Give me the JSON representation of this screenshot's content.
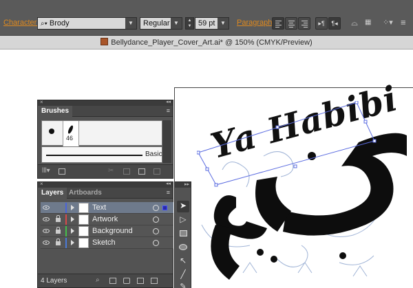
{
  "control_bar": {
    "character_label": "Character:",
    "font_value": "Brody",
    "style_value": "Regular",
    "size_value": "59 pt",
    "paragraph_label": "Paragraph:"
  },
  "document": {
    "title": "Bellydance_Player_Cover_Art.ai* @ 150% (CMYK/Preview)"
  },
  "brushes_panel": {
    "tab": "Brushes",
    "brush_size_label": "46",
    "stroke_label": "Basic"
  },
  "layers_panel": {
    "tabs": [
      "Layers",
      "Artboards"
    ],
    "layers": [
      {
        "name": "Text",
        "color": "#4a63d8",
        "selected": true
      },
      {
        "name": "Artwork",
        "color": "#d84a4a",
        "selected": false
      },
      {
        "name": "Background",
        "color": "#45c04a",
        "selected": false
      },
      {
        "name": "Sketch",
        "color": "#4a7ad8",
        "selected": false
      }
    ],
    "count": "4 Layers"
  },
  "artwork": {
    "latin_text": "Ya Habibi",
    "arabic_text": "حبيبي"
  }
}
